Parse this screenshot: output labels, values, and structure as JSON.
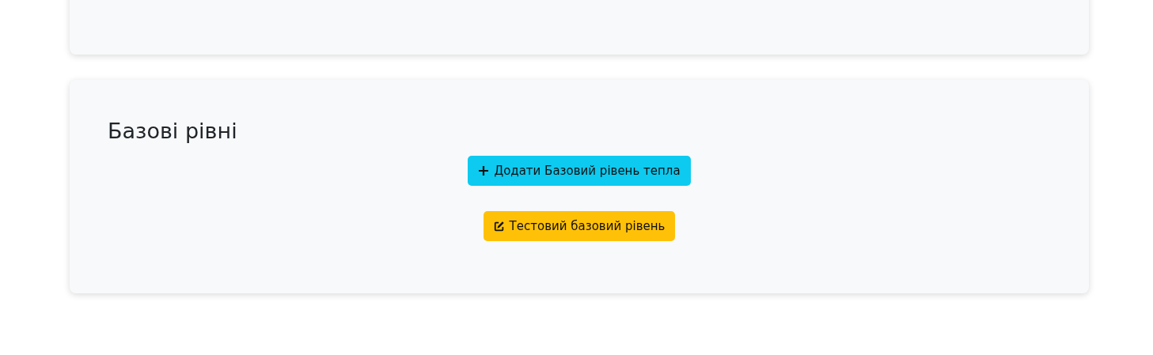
{
  "section": {
    "title": "Базові рівні",
    "buttons": [
      {
        "kind": "add",
        "label": "Додати Базовий рівень тепла"
      },
      {
        "kind": "edit",
        "label": "Тестовий базовий рівень"
      }
    ]
  }
}
